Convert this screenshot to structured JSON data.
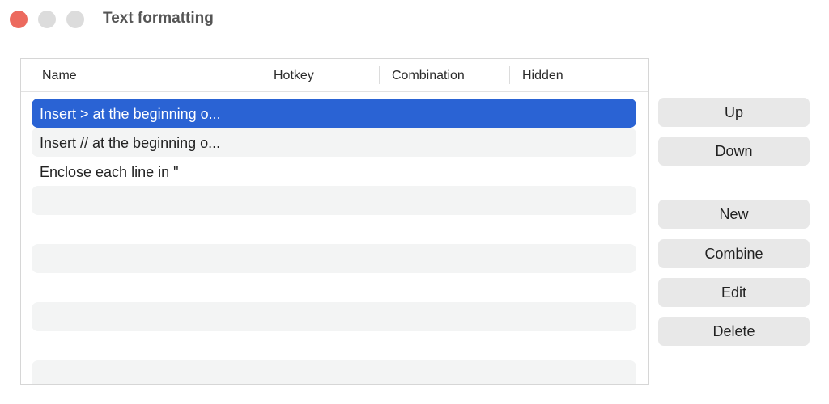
{
  "window": {
    "title": "Text formatting"
  },
  "table": {
    "columns": [
      "Name",
      "Hotkey",
      "Combination",
      "Hidden"
    ],
    "rows": [
      "Insert > at the beginning o...",
      "Insert // at the beginning o...",
      "Enclose each line in \"",
      "",
      "",
      "",
      "",
      "",
      "",
      ""
    ],
    "selected_index": 0
  },
  "buttons": {
    "up": "Up",
    "down": "Down",
    "new": "New",
    "combine": "Combine",
    "edit": "Edit",
    "delete": "Delete"
  },
  "colors": {
    "selection": "#2a63d4",
    "close_button": "#ec6a5e",
    "row_stripe": "#f3f4f4",
    "button_bg": "#e8e8e8"
  }
}
